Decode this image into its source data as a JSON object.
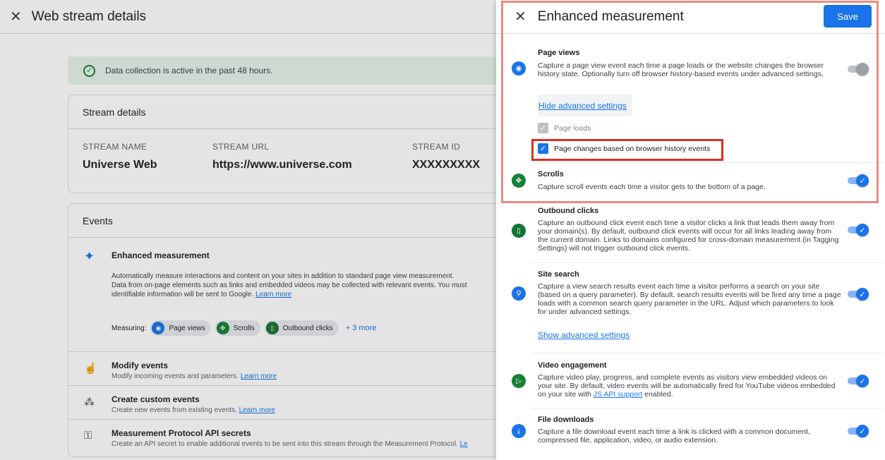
{
  "background": {
    "title": "Web stream details",
    "banner_text": "Data collection is active in the past 48 hours.",
    "stream_details": {
      "heading": "Stream details",
      "columns": [
        {
          "label": "STREAM NAME",
          "value": "Universe Web"
        },
        {
          "label": "STREAM URL",
          "value": "https://www.universe.com"
        },
        {
          "label": "STREAM ID",
          "value": "XXXXXXXXX"
        }
      ]
    },
    "events": {
      "heading": "Events",
      "enhanced": {
        "title": "Enhanced measurement",
        "desc1": "Automatically measure interactions and content on your sites in addition to standard page view measurement.",
        "desc2": "Data from on-page elements such as links and embedded videos may be collected with relevant events. You must",
        "desc3": "identifiable information will be sent to Google.",
        "learn_more": "Learn more",
        "measuring_label": "Measuring:",
        "chips": [
          "Page views",
          "Scrolls",
          "Outbound clicks"
        ],
        "more": "+ 3 more"
      },
      "rows": [
        {
          "title": "Modify events",
          "desc": "Modify incoming events and parameters.",
          "link": "Learn more"
        },
        {
          "title": "Create custom events",
          "desc": "Create new events from existing events.",
          "link": "Learn more"
        },
        {
          "title": "Measurement Protocol API secrets",
          "desc": "Create an API secret to enable additional events to be sent into this stream through the Measurement Protocol.",
          "link": "Le"
        }
      ]
    }
  },
  "panel": {
    "title": "Enhanced measurement",
    "save_label": "Save",
    "page_views": {
      "title": "Page views",
      "desc": "Capture a page view event each time a page loads or the website changes the browser history state. Optionally turn off browser history-based events under advanced settings.",
      "hide_advanced": "Hide advanced settings",
      "page_loads": "Page loads",
      "page_changes": "Page changes based on browser history events"
    },
    "scrolls": {
      "title": "Scrolls",
      "desc": "Capture scroll events each time a visitor gets to the bottom of a page."
    },
    "outbound": {
      "title": "Outbound clicks",
      "desc": "Capture an outbound click event each time a visitor clicks a link that leads them away from your domain(s). By default, outbound click events will occur for all links leading away from the current domain. Links to domains configured for cross-domain measurement (in Tagging Settings) will not trigger outbound click events."
    },
    "site_search": {
      "title": "Site search",
      "desc": "Capture a view search results event each time a visitor performs a search on your site (based on a query parameter). By default, search results events will be fired any time a page loads with a common search query parameter in the URL. Adjust which parameters to look for under advanced settings.",
      "show_advanced": "Show advanced settings"
    },
    "video": {
      "title": "Video engagement",
      "desc_before": "Capture video play, progress, and complete events as visitors view embedded videos on your site. By default, video events will be automatically fired for YouTube videos embedded on your site with ",
      "desc_link": "JS API support",
      "desc_after": " enabled."
    },
    "downloads": {
      "title": "File downloads",
      "desc": "Capture a file download event each time a link is clicked with a common document, compressed file, application, video, or audio extension."
    }
  },
  "colors": {
    "accent": "#1a73e8",
    "highlight_outer": "#ef8a80",
    "highlight_inner": "#d93025"
  }
}
